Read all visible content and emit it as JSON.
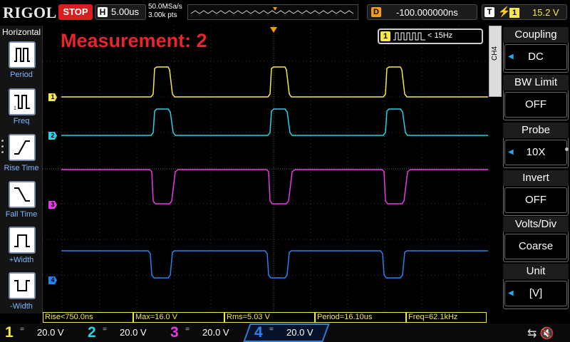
{
  "top_bar": {
    "brand": "RIGOL",
    "run_state": "STOP",
    "timebase_label": "H",
    "timebase_value": "5.00us",
    "sample_rate": "50.0MSa/s",
    "memory_depth": "3.00k pts",
    "trigger_pos_label": "D",
    "trigger_delay": "-100.000000ns",
    "trigger_type_label": "T",
    "trigger_source": "1",
    "trigger_level": "15.2 V"
  },
  "left_panel": {
    "title": "Horizontal",
    "items": [
      {
        "label": "Period",
        "icon": "period-icon"
      },
      {
        "label": "Freq",
        "icon": "freq-icon"
      },
      {
        "label": "Rise Time",
        "icon": "rise-time-icon"
      },
      {
        "label": "Fall Time",
        "icon": "fall-time-icon"
      },
      {
        "label": "+Width",
        "icon": "positive-width-icon"
      },
      {
        "label": "-Width",
        "icon": "negative-width-icon"
      }
    ]
  },
  "display": {
    "measurement_title": "Measurement: 2",
    "counter_channel": "1",
    "counter_value": "< 15Hz",
    "channel_markers": [
      "1",
      "2",
      "3",
      "4"
    ]
  },
  "right_panel": {
    "tab": "CH4",
    "menu": [
      {
        "title": "Coupling",
        "value": "DC"
      },
      {
        "title": "BW Limit",
        "value": "OFF"
      },
      {
        "title": "Probe",
        "value": "10X"
      },
      {
        "title": "Invert",
        "value": "OFF"
      },
      {
        "title": "Volts/Div",
        "value": "Coarse"
      },
      {
        "title": "Unit",
        "value": "[V]"
      }
    ]
  },
  "measurements": [
    "Rise<750.0ns",
    "Max=16.0 V",
    "Rms=5.03 V",
    "Period=16.10us",
    "Freq=62.1kHz"
  ],
  "channels": [
    {
      "num": "1",
      "coupling": "=",
      "scale": "20.0 V",
      "color": "#f6e84a"
    },
    {
      "num": "2",
      "coupling": "=",
      "scale": "20.0 V",
      "color": "#29d3e6"
    },
    {
      "num": "3",
      "coupling": "=",
      "scale": "20.0 V",
      "color": "#e63ce6"
    },
    {
      "num": "4",
      "coupling": "=",
      "scale": "20.0 V",
      "color": "#2a83f0"
    }
  ],
  "colors": {
    "ch1": "#f6e84a",
    "ch2": "#29d3e6",
    "ch3": "#e63ce6",
    "ch4": "#2a83f0",
    "stop": "#d81e1e",
    "trigger": "#f39c12",
    "title": "#e8242c"
  }
}
